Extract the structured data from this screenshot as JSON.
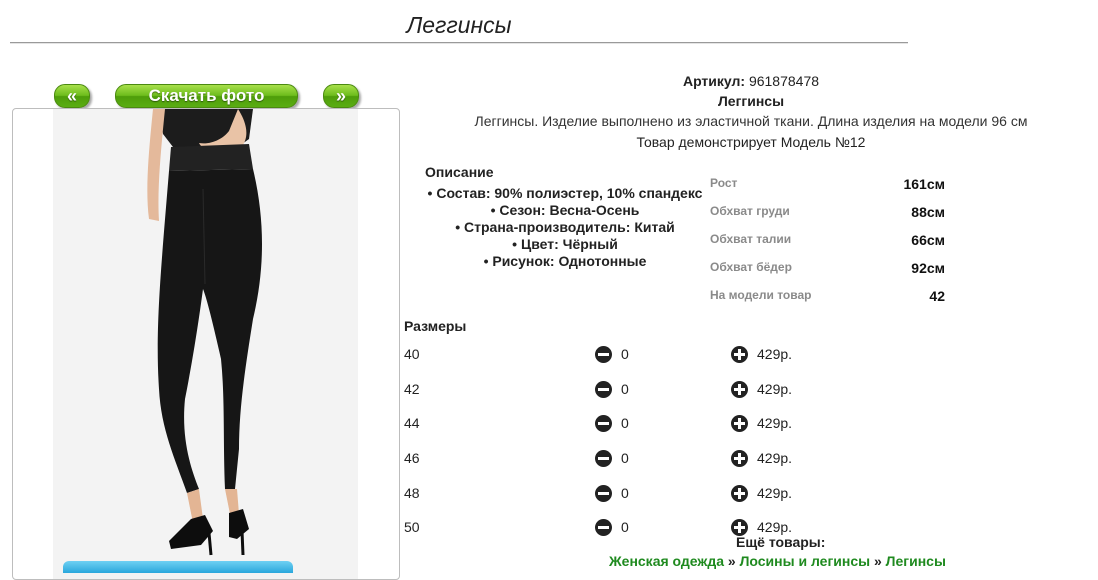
{
  "page": {
    "title": "Леггинсы"
  },
  "gallery": {
    "prev_label": "«",
    "download_label": "Скачать фото",
    "next_label": "»"
  },
  "product": {
    "article_label": "Артикул:",
    "article_value": "961878478",
    "name": "Леггинсы",
    "description": "Леггинсы. Изделие выполнено из эластичной ткани. Длина изделия на модели 96 см",
    "model_line": "Товар демонстрирует Модель №12"
  },
  "description": {
    "heading": "Описание",
    "items": [
      "Состав: 90% полиэстер, 10% спандекс",
      "Сезон: Весна-Осень",
      "Страна-производитель: Китай",
      "Цвет: Чёрный",
      "Рисунок: Однотонные"
    ]
  },
  "model_params": [
    {
      "label": "Рост",
      "value": "161см"
    },
    {
      "label": "Обхват груди",
      "value": "88см"
    },
    {
      "label": "Обхват талии",
      "value": "66см"
    },
    {
      "label": "Обхват бёдер",
      "value": "92см"
    },
    {
      "label": "На модели товар",
      "value": "42"
    }
  ],
  "sizes": {
    "heading": "Размеры",
    "rows": [
      {
        "size": "40",
        "qty": "0",
        "price": "429р."
      },
      {
        "size": "42",
        "qty": "0",
        "price": "429р."
      },
      {
        "size": "44",
        "qty": "0",
        "price": "429р."
      },
      {
        "size": "46",
        "qty": "0",
        "price": "429р."
      },
      {
        "size": "48",
        "qty": "0",
        "price": "429р."
      },
      {
        "size": "50",
        "qty": "0",
        "price": "429р."
      }
    ]
  },
  "more": {
    "heading": "Ещё товары:",
    "crumbs": [
      "Женская одежда",
      "Лосины и легинсы",
      "Легинсы"
    ],
    "separator": "»"
  },
  "colors": {
    "button_green": "#6dbc1c",
    "link_green": "#1f8a1f",
    "param_label_gray": "#8a8a8a"
  },
  "icons": [
    "minus-circle-icon",
    "plus-circle-icon"
  ]
}
